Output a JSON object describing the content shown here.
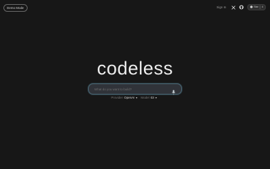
{
  "header": {
    "mode_button": "Demo Mode",
    "sign_in": "Sign In",
    "star_label": "Star",
    "star_count": "4"
  },
  "main": {
    "logo": "codeless",
    "search_placeholder": "What do you want to build?"
  },
  "selectors": {
    "provider_label": "Provider",
    "provider_value": "OpenAI",
    "model_label": "Model",
    "model_value": "03"
  },
  "colors": {
    "background": "#171717",
    "search_border": "#4a6470",
    "text": "#ececec"
  },
  "icons": [
    "x-icon",
    "github-icon",
    "github-star-icon",
    "microphone-icon",
    "chevron-down-icon"
  ]
}
